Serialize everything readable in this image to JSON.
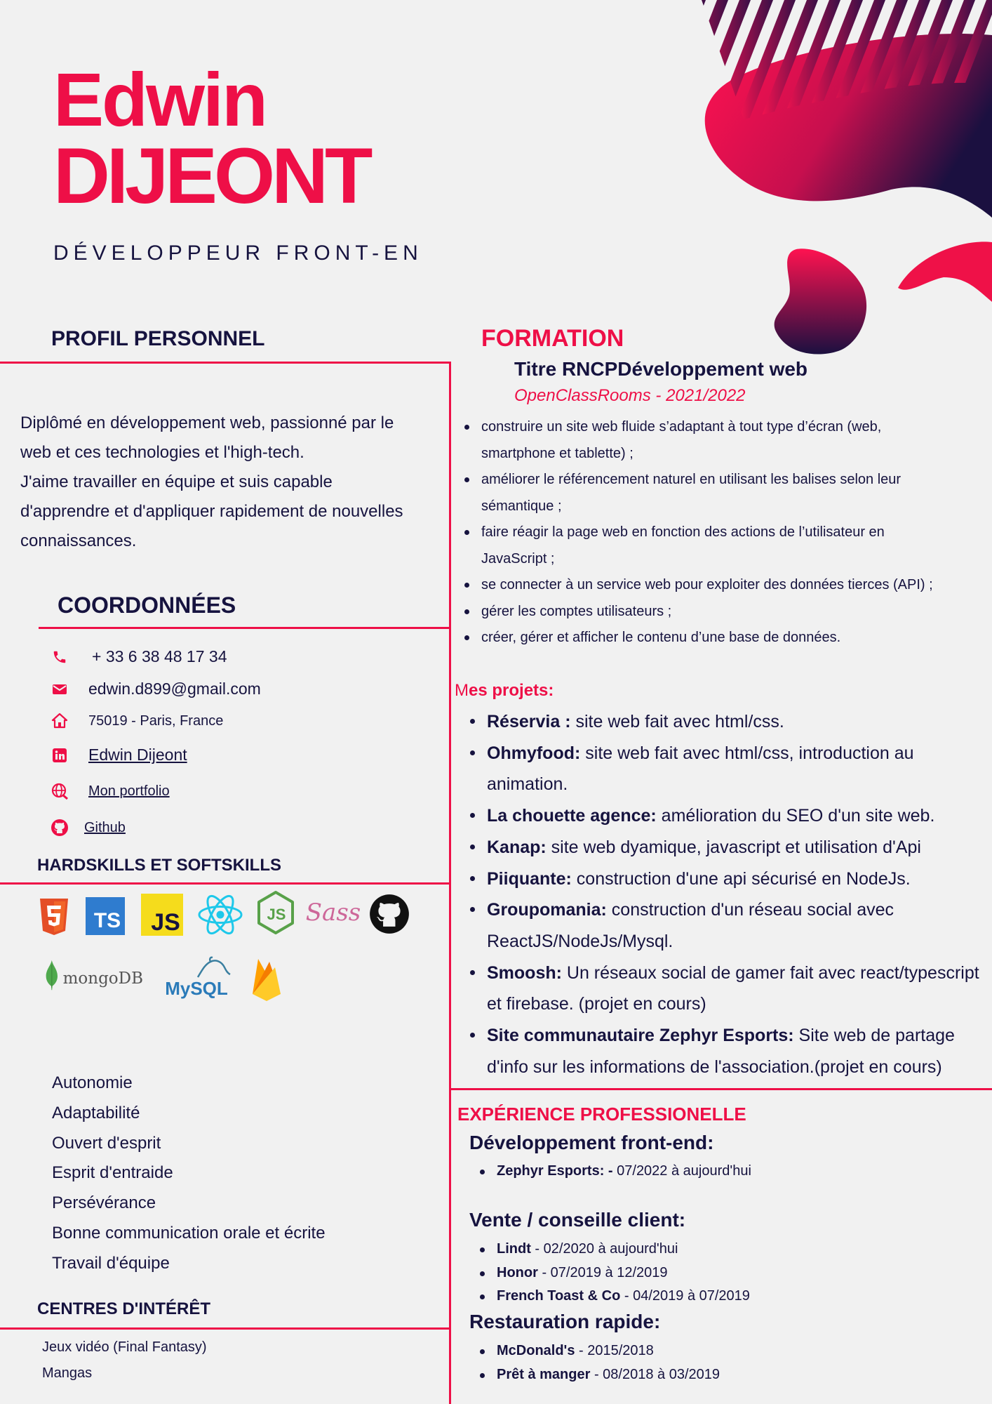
{
  "header": {
    "first_name": "Edwin",
    "last_name": "DIJEONT",
    "job_title": "DÉVELOPPEUR FRONT-EN"
  },
  "profile": {
    "title": "PROFIL PERSONNEL",
    "lines": [
      "Diplômé en développement web, passionné par le",
      "web et ces technologies et l'high-tech.",
      "J'aime travailler en équipe et suis capable",
      "d'apprendre et d'appliquer rapidement de nouvelles",
      "connaissances."
    ]
  },
  "contact": {
    "title": "COORDONNÉES",
    "phone": "+ 33 6 38 48 17 34",
    "email": "edwin.d899@gmail.com",
    "address": "75019 - Paris, France",
    "linkedin": "Edwin Dijeont",
    "portfolio": "Mon portfolio",
    "github": "Github",
    "icons": [
      "phone-icon",
      "mail-icon",
      "home-icon",
      "linkedin-icon",
      "globe-icon",
      "github-icon"
    ]
  },
  "skills": {
    "title": "HARDSKILLS ET SOFTSKILLS",
    "logos": {
      "ts": "TS",
      "js": "JS",
      "sass": "Sass",
      "mongodb": "mongoDB",
      "mysql": "MySQL"
    },
    "soft": [
      "Autonomie",
      "Adaptabilité",
      "Ouvert d'esprit",
      "Esprit d'entraide",
      "Persévérance",
      "Bonne communication orale et écrite",
      "Travail d'équipe"
    ]
  },
  "interests": {
    "title": "CENTRES D'INTÉRÊT",
    "items": [
      "Jeux vidéo (Final Fantasy)",
      "Mangas"
    ]
  },
  "formation": {
    "title": "FORMATION",
    "degree": "Titre RNCPDéveloppement web",
    "school": "OpenClassRooms - 2021/2022",
    "items": [
      [
        "construire un site web fluide s’adaptant à tout type d’écran (web,",
        "smartphone et tablette) ;"
      ],
      [
        "améliorer le référencement naturel en utilisant les balises selon leur",
        "sémantique ;"
      ],
      [
        "faire réagir la page web en fonction des actions de l’utilisateur en",
        "JavaScript ;"
      ],
      [
        "se connecter à un service web pour exploiter des données tierces (API) ;"
      ],
      [
        "gérer les comptes utilisateurs ;"
      ],
      [
        "créer, gérer et afficher le contenu d’une base de données."
      ]
    ]
  },
  "projects": {
    "title_first": "M",
    "title_rest": "es projets:",
    "items": [
      {
        "name": "Réservia :",
        "desc": " site web fait avec html/css."
      },
      {
        "name": "Ohmyfood:",
        "desc": " site web fait avec html/css, introduction au animation."
      },
      {
        "name": "La chouette agence:",
        "desc": " amélioration du SEO d'un site web."
      },
      {
        "name": "Kanap:",
        "desc": " site web dyamique, javascript et utilisation d'Api"
      },
      {
        "name": "Piiquante:",
        "desc": " construction d'une api sécurisé en NodeJs."
      },
      {
        "name": "Groupomania:",
        "desc": " construction d'un réseau social avec ReactJS/NodeJs/Mysql."
      },
      {
        "name": "Smoosh:",
        "desc": " Un réseaux social de gamer fait avec react/typescript et firebase. (projet en cours)"
      },
      {
        "name": "Site communautaire Zephyr Esports:",
        "desc": " Site web de partage d'info sur les informations de l'association.(projet en cours)"
      }
    ]
  },
  "experience": {
    "title": "EXPÉRIENCE PROFESSIONELLE",
    "groups": [
      {
        "title": "Développement front-end:",
        "items": [
          {
            "name": "Zephyr Esports: -",
            "period": " 07/2022 à aujourd'hui"
          }
        ]
      },
      {
        "title": "Vente / conseille client:",
        "items": [
          {
            "name": "Lindt",
            "period": " - 02/2020 à aujourd'hui"
          },
          {
            "name": "Honor",
            "period": " - 07/2019 à 12/2019"
          },
          {
            "name": "French Toast & Co",
            "period": " - 04/2019 à 07/2019"
          }
        ]
      },
      {
        "title": "Restauration rapide:",
        "items": [
          {
            "name": "McDonald's",
            "period": " - 2015/2018"
          },
          {
            "name": "Prêt à manger",
            "period": " - 08/2018 à 03/2019"
          }
        ]
      }
    ]
  },
  "colors": {
    "accent": "#ee0f47",
    "navy": "#16133f",
    "background": "#f1f1f1"
  }
}
